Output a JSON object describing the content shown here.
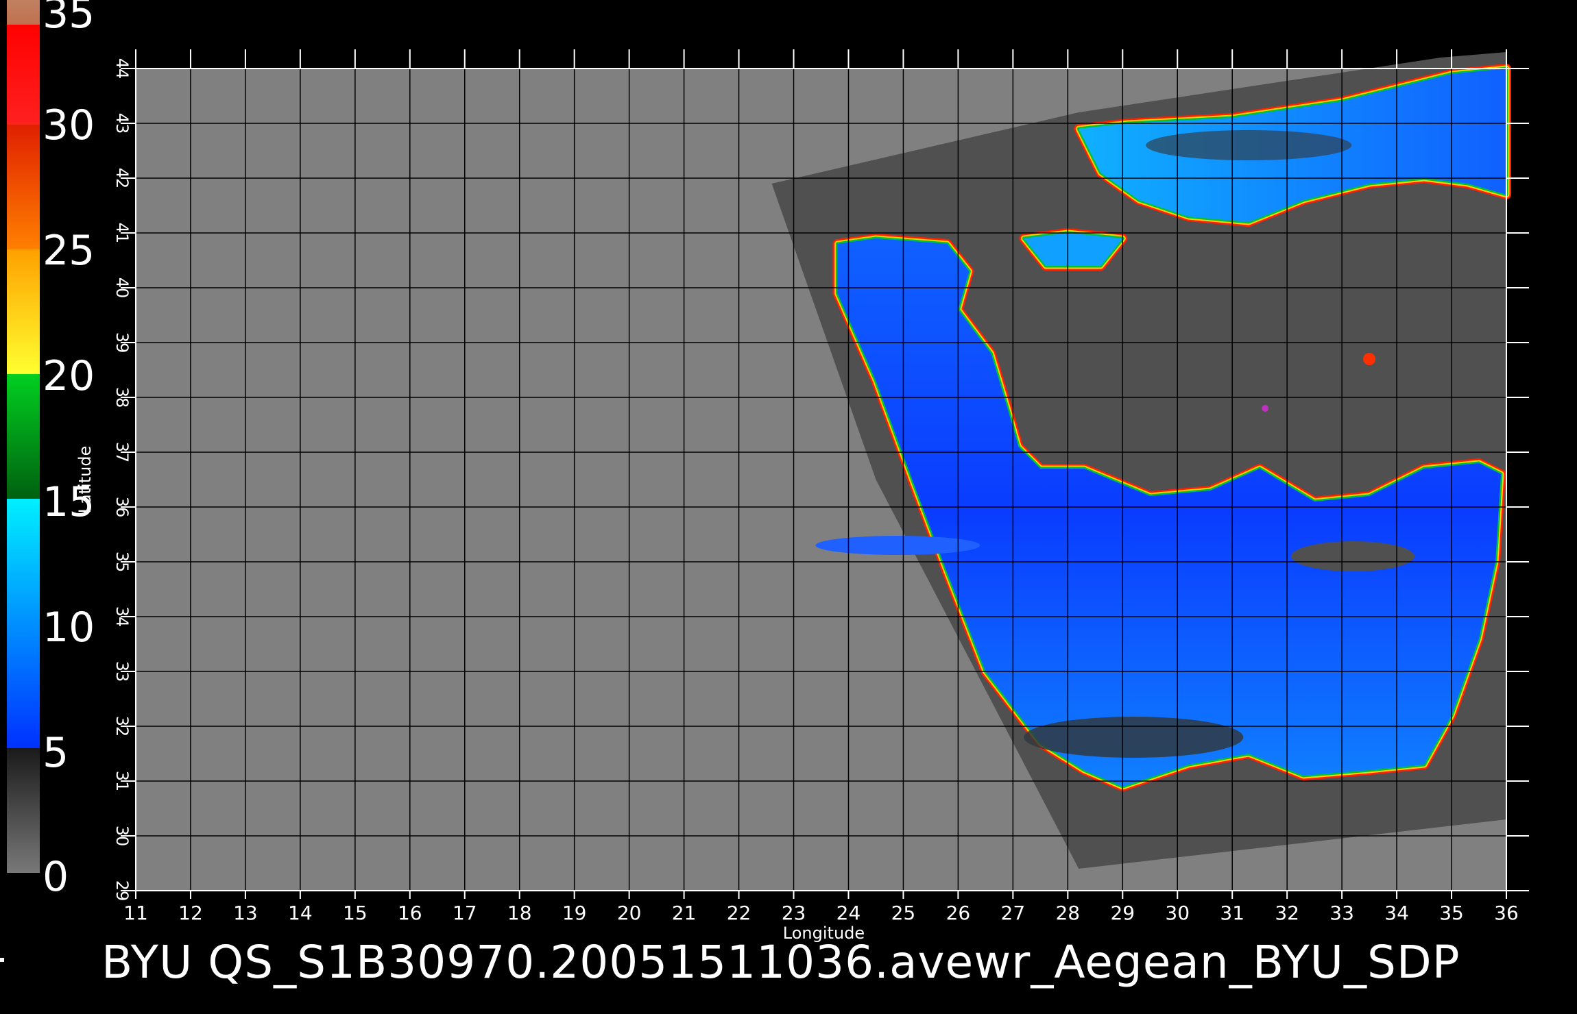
{
  "title": "BYU  QS_S1B30970.20051511036.avewr_Aegean_BYU_SDP",
  "colorbar": {
    "labels": [
      "35",
      "30",
      "25",
      "20",
      "15",
      "10",
      "5",
      "0"
    ],
    "segments": [
      {
        "from": 0,
        "to": 5,
        "colors": [
          "#787878",
          "#1a1a1a"
        ]
      },
      {
        "from": 5,
        "to": 15,
        "colors": [
          "#0030ff",
          "#00f0ff"
        ]
      },
      {
        "from": 15,
        "to": 20,
        "colors": [
          "#006010",
          "#00d020"
        ]
      },
      {
        "from": 20,
        "to": 25,
        "colors": [
          "#ffff30",
          "#ffa000"
        ]
      },
      {
        "from": 25,
        "to": 30,
        "colors": [
          "#ff8000",
          "#e02000"
        ]
      },
      {
        "from": 30,
        "to": 34,
        "colors": [
          "#ff2020",
          "#ff0000"
        ]
      },
      {
        "from": 34,
        "to": 35,
        "colors": [
          "#c07050",
          "#c08060"
        ]
      }
    ]
  },
  "map": {
    "lon_range": [
      11,
      36
    ],
    "lat_range": [
      29,
      44
    ],
    "x_ticks": [
      "11",
      "12",
      "13",
      "14",
      "15",
      "16",
      "17",
      "18",
      "19",
      "20",
      "21",
      "22",
      "23",
      "24",
      "25",
      "26",
      "27",
      "28",
      "29",
      "30",
      "31",
      "32",
      "33",
      "34",
      "35",
      "36"
    ],
    "y_ticks": [
      "29",
      "30",
      "31",
      "32",
      "33",
      "34",
      "35",
      "36",
      "37",
      "38",
      "39",
      "40",
      "41",
      "42",
      "43",
      "44"
    ],
    "xlabel": "Longitude",
    "ylabel": "Latitude",
    "background_color": "#808080",
    "swath_color": "#505050"
  }
}
